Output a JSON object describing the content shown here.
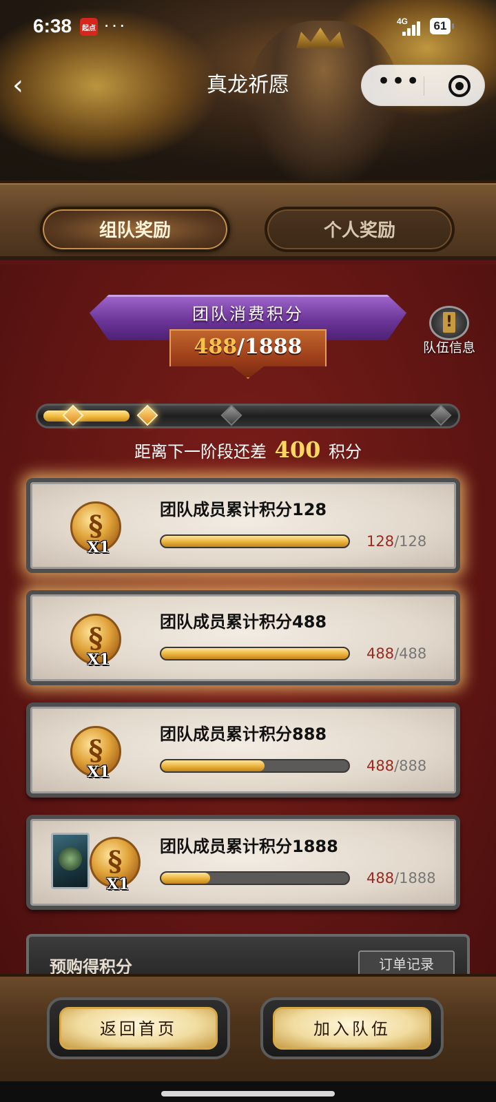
{
  "status_bar": {
    "time": "6:38",
    "app_badge": "起点",
    "menu_dots": "···",
    "network": "4G",
    "battery": "61"
  },
  "nav": {
    "back_icon": "chevron-left-icon",
    "title": "真龙祈愿",
    "capsule_more": "•••",
    "capsule_close_icon": "target-circle-icon"
  },
  "tabs": [
    {
      "label": "组队奖励",
      "active": true
    },
    {
      "label": "个人奖励",
      "active": false
    }
  ],
  "score": {
    "title": "团队消费积分",
    "current": "488",
    "separator": "/",
    "target": "1888"
  },
  "team_info": {
    "label": "队伍信息",
    "icon": "info-book-icon"
  },
  "stage_progress": {
    "fraction": 0.21,
    "nodes_active": [
      true,
      true,
      false,
      false
    ],
    "hint_prefix": "距离下一阶段还差",
    "hint_value": "400",
    "hint_suffix": "积分"
  },
  "rewards": [
    {
      "title": "团队成员累计积分128",
      "current": "128",
      "target": "128",
      "fraction": 1.0,
      "count": "X1",
      "has_card": false,
      "glow": true
    },
    {
      "title": "团队成员累计积分488",
      "current": "488",
      "target": "488",
      "fraction": 1.0,
      "count": "X1",
      "has_card": false,
      "glow": true
    },
    {
      "title": "团队成员累计积分888",
      "current": "488",
      "target": "888",
      "fraction": 0.55,
      "count": "X1",
      "has_card": false,
      "glow": false
    },
    {
      "title": "团队成员累计积分1888",
      "current": "488",
      "target": "1888",
      "fraction": 0.26,
      "count": "X1",
      "has_card": true,
      "glow": false
    }
  ],
  "preorder": {
    "title": "预购得积分",
    "order_record": "订单记录"
  },
  "bottom_buttons": {
    "home": "返回首页",
    "join": "加入队伍"
  },
  "colors": {
    "main_red": "#5b1412",
    "gold": "#f0b93a",
    "purple_ribbon": "#6b3598",
    "progress_current": "#9a2a20"
  }
}
